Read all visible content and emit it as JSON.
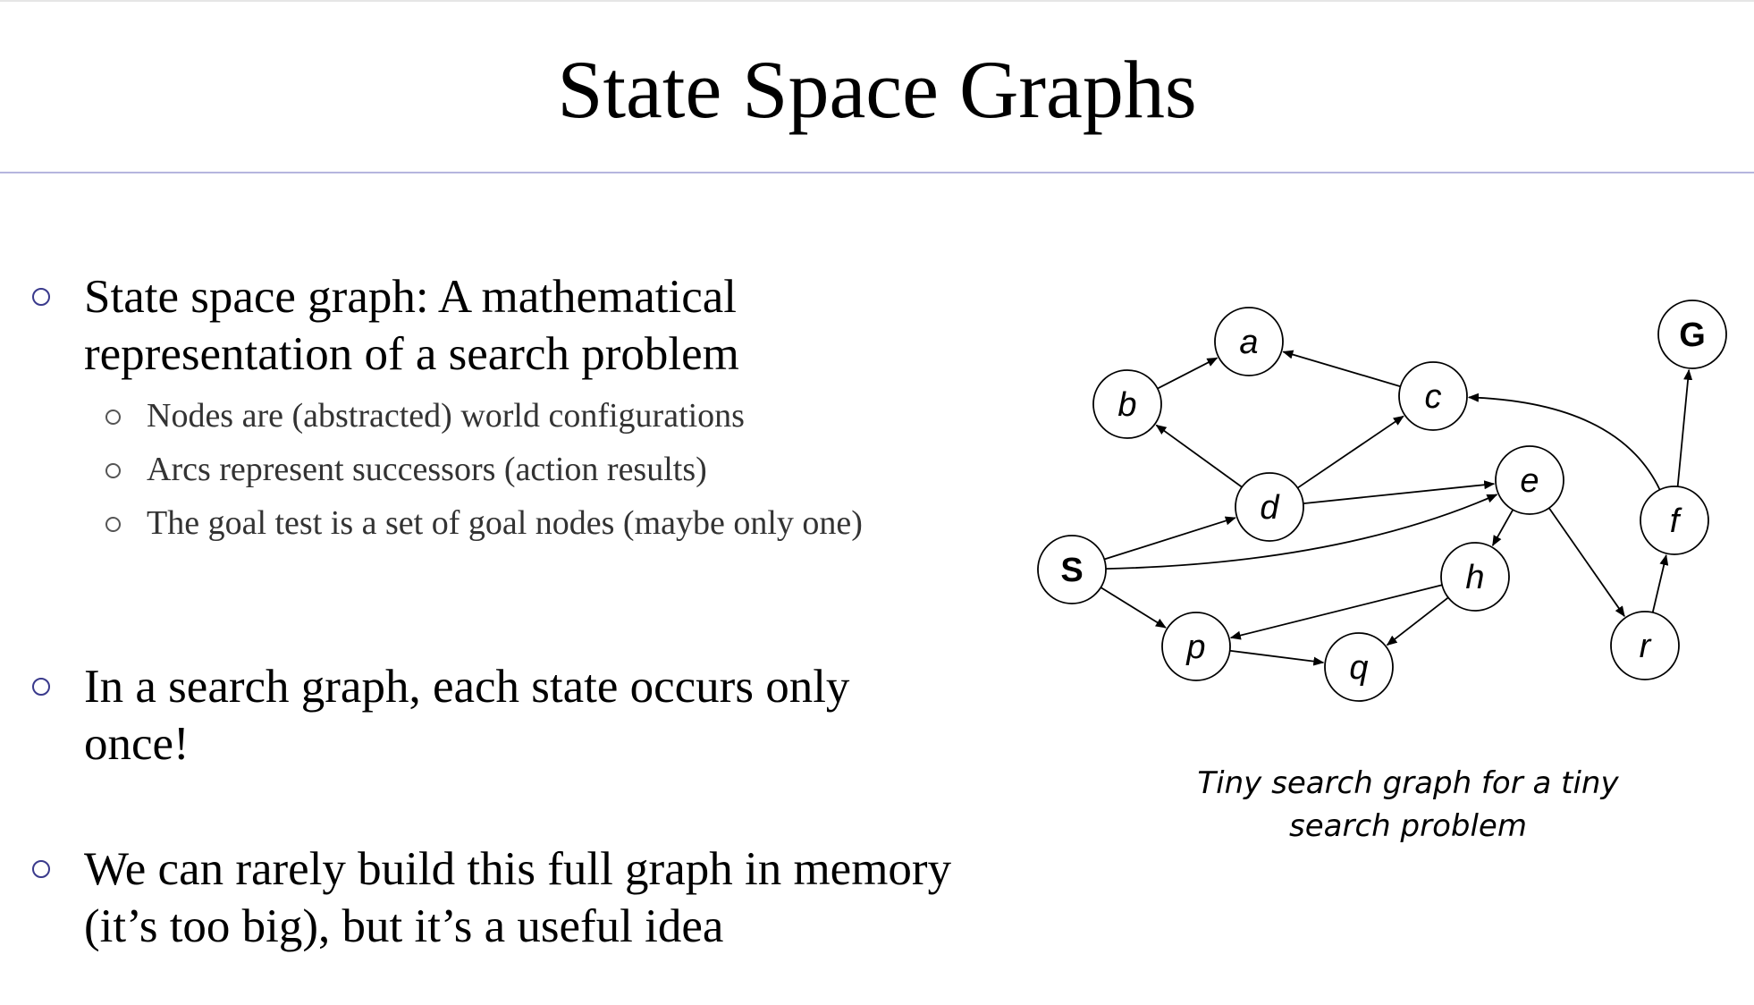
{
  "slide": {
    "title": "State Space Graphs",
    "bullets": [
      {
        "text": "State space graph: A mathematical representation of a search problem",
        "sub": [
          "Nodes are (abstracted) world configurations",
          "Arcs represent successors (action results)",
          "The goal test is a set of goal nodes (maybe only one)"
        ]
      },
      {
        "text": "In a search graph, each state occurs only once!"
      },
      {
        "text": "We can rarely build this full graph in memory (it’s too big), but it’s a useful idea"
      }
    ],
    "caption": "Tiny search graph for a tiny search problem"
  },
  "graph": {
    "nodes": [
      {
        "id": "S",
        "label": "S"
      },
      {
        "id": "a",
        "label": "a"
      },
      {
        "id": "b",
        "label": "b"
      },
      {
        "id": "c",
        "label": "c"
      },
      {
        "id": "d",
        "label": "d"
      },
      {
        "id": "e",
        "label": "e"
      },
      {
        "id": "f",
        "label": "f"
      },
      {
        "id": "G",
        "label": "G"
      },
      {
        "id": "h",
        "label": "h"
      },
      {
        "id": "p",
        "label": "p"
      },
      {
        "id": "q",
        "label": "q"
      },
      {
        "id": "r",
        "label": "r"
      }
    ],
    "edges": [
      {
        "from": "S",
        "to": "d"
      },
      {
        "from": "S",
        "to": "e"
      },
      {
        "from": "S",
        "to": "p"
      },
      {
        "from": "b",
        "to": "a"
      },
      {
        "from": "c",
        "to": "a"
      },
      {
        "from": "d",
        "to": "b"
      },
      {
        "from": "d",
        "to": "c"
      },
      {
        "from": "d",
        "to": "e"
      },
      {
        "from": "e",
        "to": "h"
      },
      {
        "from": "e",
        "to": "r"
      },
      {
        "from": "f",
        "to": "c"
      },
      {
        "from": "f",
        "to": "G"
      },
      {
        "from": "h",
        "to": "p"
      },
      {
        "from": "h",
        "to": "q"
      },
      {
        "from": "p",
        "to": "q"
      },
      {
        "from": "r",
        "to": "f"
      }
    ]
  }
}
